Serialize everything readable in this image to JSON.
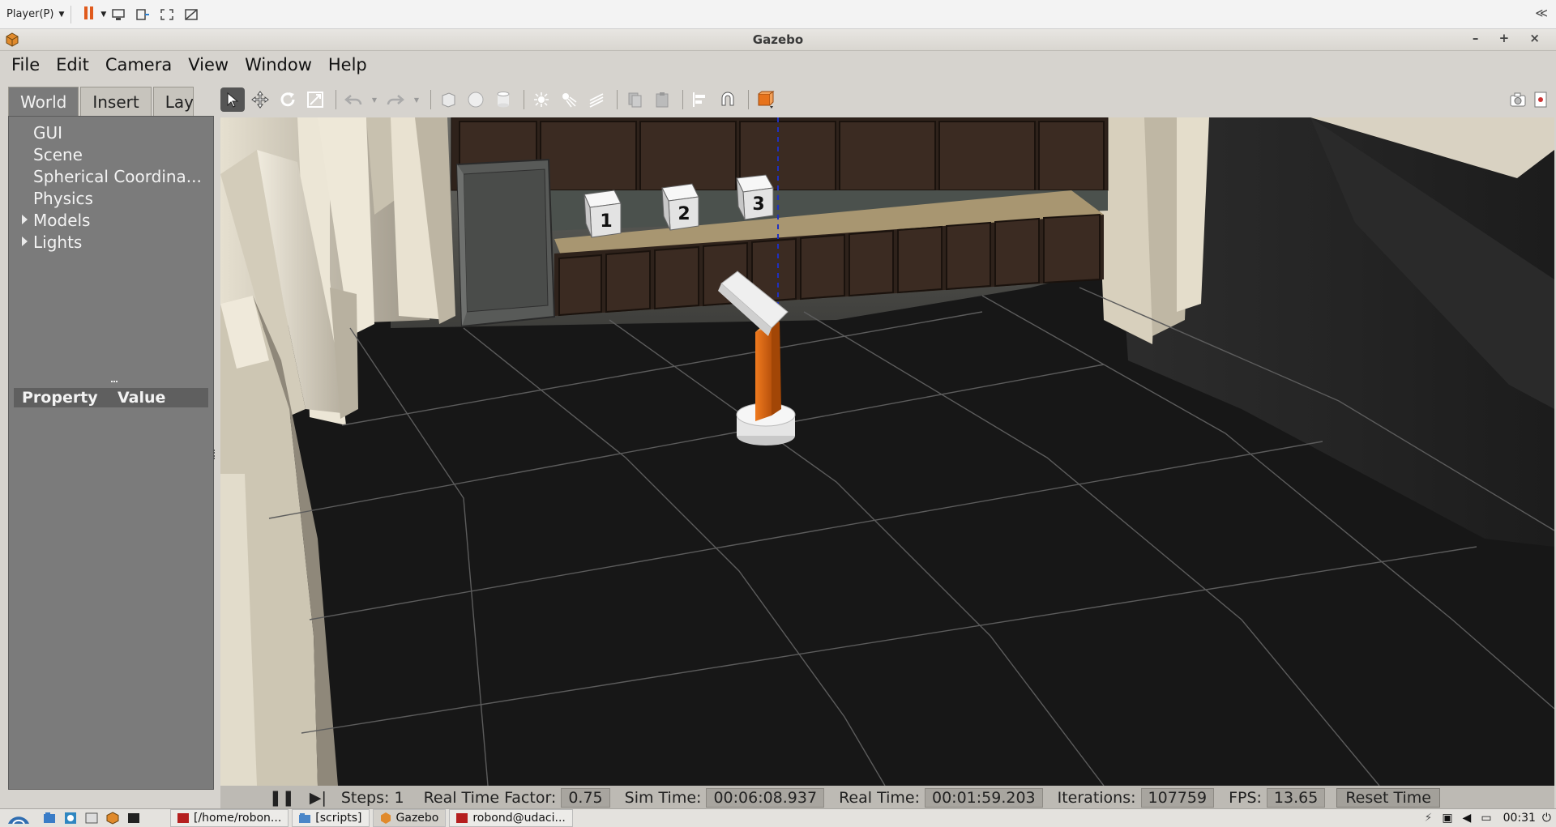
{
  "player": {
    "label": "Player(P)",
    "collapse": "≪"
  },
  "window": {
    "title": "Gazebo",
    "controls": "– + ×"
  },
  "menu": [
    "File",
    "Edit",
    "Camera",
    "View",
    "Window",
    "Help"
  ],
  "left_panel": {
    "tabs": [
      "World",
      "Insert",
      "Laye"
    ],
    "tree": [
      "GUI",
      "Scene",
      "Spherical Coordina...",
      "Physics",
      "Models",
      "Lights"
    ],
    "property_header": {
      "property": "Property",
      "value": "Value"
    }
  },
  "scene": {
    "cubes": [
      "1",
      "2",
      "3"
    ],
    "colors": {
      "arm": "#e06b12",
      "floor": "#161616",
      "walls": "#cfc8b6",
      "cabinet": "#3a2820"
    }
  },
  "status": {
    "steps_label": "Steps: 1",
    "rtf_label": "Real Time Factor:",
    "rtf": "0.75",
    "sim_label": "Sim Time:",
    "sim": "00:06:08.937",
    "real_label": "Real Time:",
    "real": "00:01:59.203",
    "iter_label": "Iterations:",
    "iter": "107759",
    "fps_label": "FPS:",
    "fps": "13.65",
    "reset": "Reset Time"
  },
  "taskbar": {
    "tasks": [
      "[/home/robon...",
      "[scripts]",
      "Gazebo",
      "robond@udaci..."
    ],
    "clock": "00:31"
  }
}
